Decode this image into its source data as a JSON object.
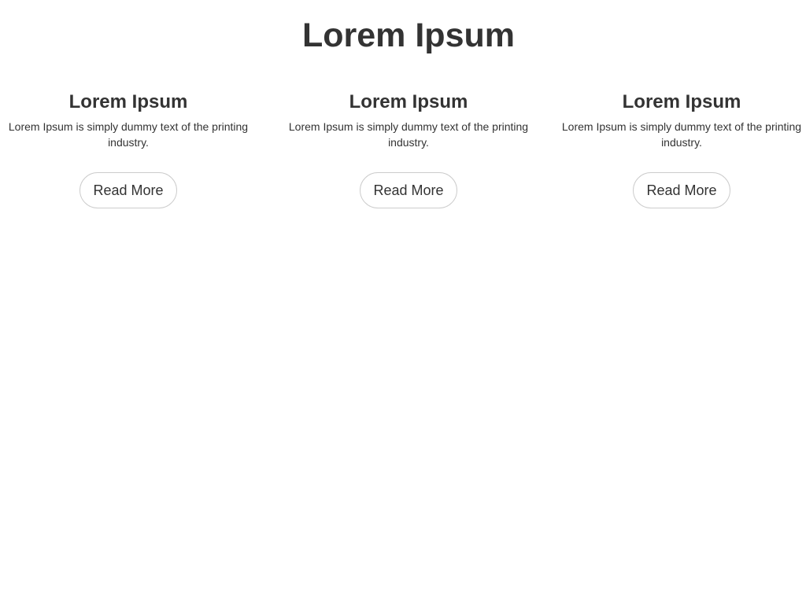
{
  "header": {
    "title": "Lorem Ipsum"
  },
  "features": [
    {
      "title": "Lorem Ipsum",
      "text": "Lorem Ipsum is simply dummy text of the printing industry.",
      "button_label": "Read More"
    },
    {
      "title": "Lorem Ipsum",
      "text": "Lorem Ipsum is simply dummy text of the printing industry.",
      "button_label": "Read More"
    },
    {
      "title": "Lorem Ipsum",
      "text": "Lorem Ipsum is simply dummy text of the printing industry.",
      "button_label": "Read More"
    }
  ],
  "colors": {
    "background": "#ffffff",
    "text": "#333333",
    "button_border": "#cccccc"
  }
}
